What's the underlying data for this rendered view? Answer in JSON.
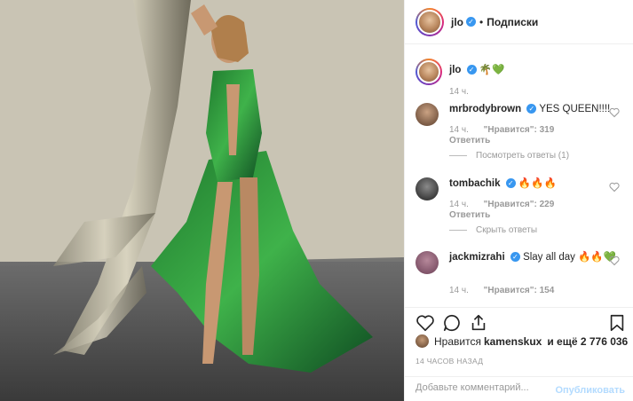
{
  "post": {
    "username": "jlo",
    "follow_label": "Подписки",
    "separator": "•"
  },
  "caption": {
    "username": "jlo",
    "text": "🌴💚",
    "time": "14 ч."
  },
  "comments": [
    {
      "username": "mrbrodybrown",
      "text": "YES QUEEN!!!!",
      "time": "14 ч.",
      "likes": "\"Нравится\": 319",
      "reply": "Ответить",
      "thread": "Посмотреть ответы (1)"
    },
    {
      "username": "tombachik",
      "text": "🔥🔥🔥",
      "time": "14 ч.",
      "likes": "\"Нравится\": 229",
      "reply": "Ответить",
      "thread": "Скрыть ответы"
    },
    {
      "username": "jackmizrahi",
      "text": "Slay all day 🔥🔥💚",
      "time": "14 ч.",
      "likes": "\"Нравится\": 154"
    }
  ],
  "likes_line": {
    "prefix": "Нравится",
    "user": "kamenskux",
    "suffix": "и ещё 2 776 036"
  },
  "timestamp": "14 ЧАСОВ НАЗАД",
  "add_comment": {
    "placeholder": "Добавьте комментарий...",
    "publish": "Опубликовать"
  },
  "icons": [
    "heart-icon",
    "comment-icon",
    "share-icon",
    "bookmark-icon",
    "verified-icon"
  ],
  "colors": {
    "verified": "#3897f0",
    "publish_disabled": "#b3dbff"
  }
}
